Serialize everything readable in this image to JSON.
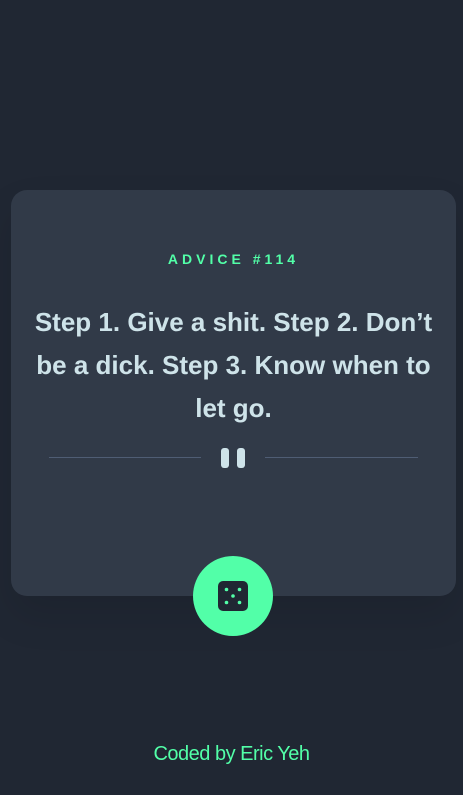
{
  "card": {
    "advice_id": "ADVICE #114",
    "advice_text": "Step 1. Give a shit. Step 2. Don’t be a dick. Step 3. Know when to let go."
  },
  "controls": {
    "dice_icon": "dice-icon"
  },
  "footer": {
    "credit": "Coded by Eric Yeh"
  },
  "colors": {
    "background": "#202733",
    "card": "#313a48",
    "accent": "#52ffa8",
    "text": "#cee3e9",
    "divider": "#4f5d74"
  }
}
